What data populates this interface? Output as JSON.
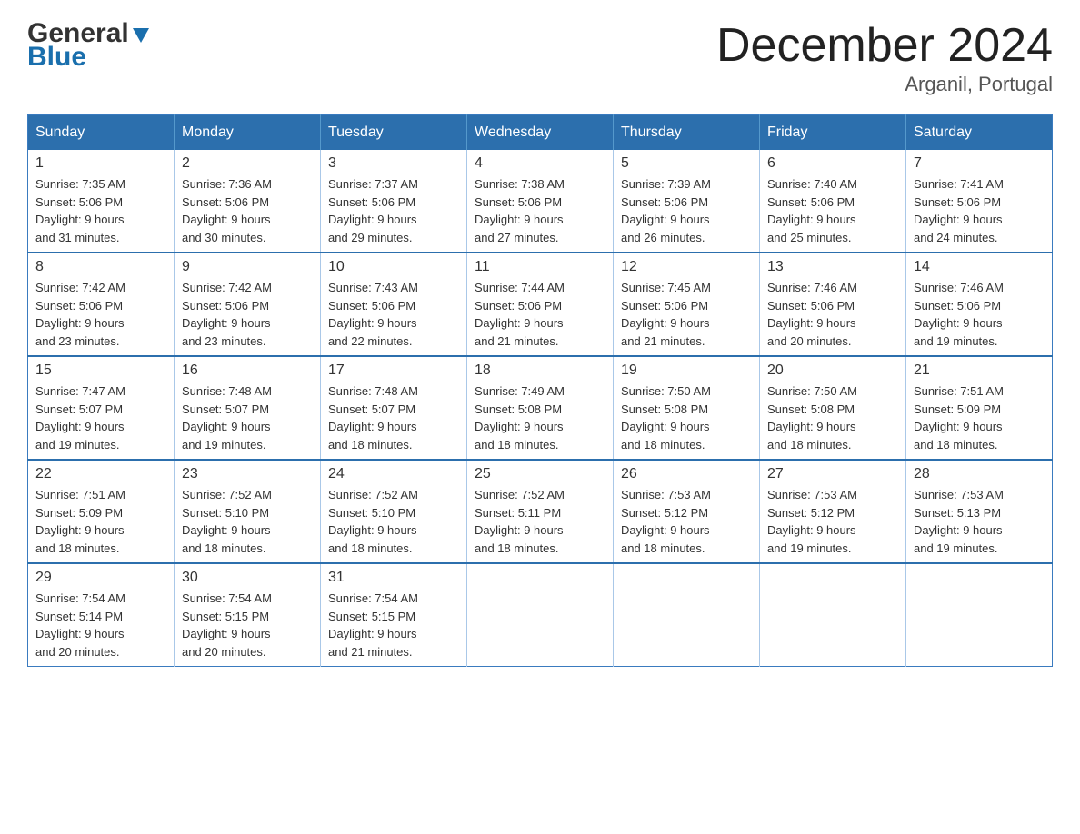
{
  "header": {
    "logo_general": "General",
    "logo_blue": "Blue",
    "title": "December 2024",
    "subtitle": "Arganil, Portugal"
  },
  "weekdays": [
    "Sunday",
    "Monday",
    "Tuesday",
    "Wednesday",
    "Thursday",
    "Friday",
    "Saturday"
  ],
  "weeks": [
    [
      {
        "day": "1",
        "sunrise": "7:35 AM",
        "sunset": "5:06 PM",
        "daylight": "9 hours and 31 minutes."
      },
      {
        "day": "2",
        "sunrise": "7:36 AM",
        "sunset": "5:06 PM",
        "daylight": "9 hours and 30 minutes."
      },
      {
        "day": "3",
        "sunrise": "7:37 AM",
        "sunset": "5:06 PM",
        "daylight": "9 hours and 29 minutes."
      },
      {
        "day": "4",
        "sunrise": "7:38 AM",
        "sunset": "5:06 PM",
        "daylight": "9 hours and 27 minutes."
      },
      {
        "day": "5",
        "sunrise": "7:39 AM",
        "sunset": "5:06 PM",
        "daylight": "9 hours and 26 minutes."
      },
      {
        "day": "6",
        "sunrise": "7:40 AM",
        "sunset": "5:06 PM",
        "daylight": "9 hours and 25 minutes."
      },
      {
        "day": "7",
        "sunrise": "7:41 AM",
        "sunset": "5:06 PM",
        "daylight": "9 hours and 24 minutes."
      }
    ],
    [
      {
        "day": "8",
        "sunrise": "7:42 AM",
        "sunset": "5:06 PM",
        "daylight": "9 hours and 23 minutes."
      },
      {
        "day": "9",
        "sunrise": "7:42 AM",
        "sunset": "5:06 PM",
        "daylight": "9 hours and 23 minutes."
      },
      {
        "day": "10",
        "sunrise": "7:43 AM",
        "sunset": "5:06 PM",
        "daylight": "9 hours and 22 minutes."
      },
      {
        "day": "11",
        "sunrise": "7:44 AM",
        "sunset": "5:06 PM",
        "daylight": "9 hours and 21 minutes."
      },
      {
        "day": "12",
        "sunrise": "7:45 AM",
        "sunset": "5:06 PM",
        "daylight": "9 hours and 21 minutes."
      },
      {
        "day": "13",
        "sunrise": "7:46 AM",
        "sunset": "5:06 PM",
        "daylight": "9 hours and 20 minutes."
      },
      {
        "day": "14",
        "sunrise": "7:46 AM",
        "sunset": "5:06 PM",
        "daylight": "9 hours and 19 minutes."
      }
    ],
    [
      {
        "day": "15",
        "sunrise": "7:47 AM",
        "sunset": "5:07 PM",
        "daylight": "9 hours and 19 minutes."
      },
      {
        "day": "16",
        "sunrise": "7:48 AM",
        "sunset": "5:07 PM",
        "daylight": "9 hours and 19 minutes."
      },
      {
        "day": "17",
        "sunrise": "7:48 AM",
        "sunset": "5:07 PM",
        "daylight": "9 hours and 18 minutes."
      },
      {
        "day": "18",
        "sunrise": "7:49 AM",
        "sunset": "5:08 PM",
        "daylight": "9 hours and 18 minutes."
      },
      {
        "day": "19",
        "sunrise": "7:50 AM",
        "sunset": "5:08 PM",
        "daylight": "9 hours and 18 minutes."
      },
      {
        "day": "20",
        "sunrise": "7:50 AM",
        "sunset": "5:08 PM",
        "daylight": "9 hours and 18 minutes."
      },
      {
        "day": "21",
        "sunrise": "7:51 AM",
        "sunset": "5:09 PM",
        "daylight": "9 hours and 18 minutes."
      }
    ],
    [
      {
        "day": "22",
        "sunrise": "7:51 AM",
        "sunset": "5:09 PM",
        "daylight": "9 hours and 18 minutes."
      },
      {
        "day": "23",
        "sunrise": "7:52 AM",
        "sunset": "5:10 PM",
        "daylight": "9 hours and 18 minutes."
      },
      {
        "day": "24",
        "sunrise": "7:52 AM",
        "sunset": "5:10 PM",
        "daylight": "9 hours and 18 minutes."
      },
      {
        "day": "25",
        "sunrise": "7:52 AM",
        "sunset": "5:11 PM",
        "daylight": "9 hours and 18 minutes."
      },
      {
        "day": "26",
        "sunrise": "7:53 AM",
        "sunset": "5:12 PM",
        "daylight": "9 hours and 18 minutes."
      },
      {
        "day": "27",
        "sunrise": "7:53 AM",
        "sunset": "5:12 PM",
        "daylight": "9 hours and 19 minutes."
      },
      {
        "day": "28",
        "sunrise": "7:53 AM",
        "sunset": "5:13 PM",
        "daylight": "9 hours and 19 minutes."
      }
    ],
    [
      {
        "day": "29",
        "sunrise": "7:54 AM",
        "sunset": "5:14 PM",
        "daylight": "9 hours and 20 minutes."
      },
      {
        "day": "30",
        "sunrise": "7:54 AM",
        "sunset": "5:15 PM",
        "daylight": "9 hours and 20 minutes."
      },
      {
        "day": "31",
        "sunrise": "7:54 AM",
        "sunset": "5:15 PM",
        "daylight": "9 hours and 21 minutes."
      },
      null,
      null,
      null,
      null
    ]
  ],
  "labels": {
    "sunrise": "Sunrise:",
    "sunset": "Sunset:",
    "daylight": "Daylight:"
  }
}
